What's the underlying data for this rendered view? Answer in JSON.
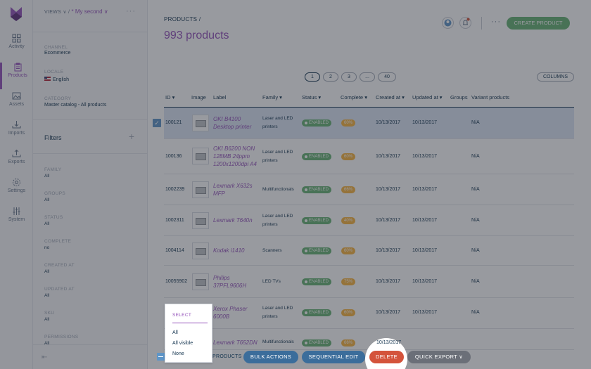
{
  "nav": {
    "items": [
      {
        "label": "Activity",
        "icon": "grid-icon"
      },
      {
        "label": "Products",
        "icon": "clipboard-icon"
      },
      {
        "label": "Assets",
        "icon": "image-icon"
      },
      {
        "label": "Imports",
        "icon": "import-icon"
      },
      {
        "label": "Exports",
        "icon": "export-icon"
      },
      {
        "label": "Settings",
        "icon": "gear-icon"
      },
      {
        "label": "System",
        "icon": "sliders-icon"
      }
    ],
    "active": "Products",
    "accent": "#9452ba"
  },
  "sidebar": {
    "views_label": "VIEWS",
    "view_selected": "* My second",
    "channel": {
      "label": "CHANNEL",
      "value": "Ecommerce"
    },
    "locale": {
      "label": "LOCALE",
      "value": "English"
    },
    "category": {
      "label": "CATEGORY",
      "value": "Master catalog - All products"
    },
    "filters_title": "Filters",
    "filters": [
      {
        "label": "FAMILY",
        "value": "All"
      },
      {
        "label": "GROUPS",
        "value": "All"
      },
      {
        "label": "STATUS",
        "value": "All"
      },
      {
        "label": "COMPLETE",
        "value": "no"
      },
      {
        "label": "CREATED AT",
        "value": "All"
      },
      {
        "label": "UPDATED AT",
        "value": "All"
      },
      {
        "label": "SKU",
        "value": "All"
      },
      {
        "label": "PERMISSIONS",
        "value": "All"
      }
    ]
  },
  "header": {
    "breadcrumb": "PRODUCTS /",
    "count": "993 products",
    "create_label": "CREATE PRODUCT",
    "more": "···"
  },
  "pager": {
    "pages": [
      "1",
      "2",
      "3",
      "...",
      "40"
    ],
    "current": "1",
    "columns_label": "COLUMNS"
  },
  "table": {
    "headers": {
      "id": "ID",
      "image": "Image",
      "label": "Label",
      "family": "Family",
      "status": "Status",
      "complete": "Complete",
      "created": "Created at",
      "updated": "Updated at",
      "groups": "Groups",
      "variants": "Variant products"
    },
    "rows": [
      {
        "id": "100121",
        "label": [
          "OKI B4100",
          "Desktop printer"
        ],
        "family": [
          "Laser and LED",
          "printers"
        ],
        "status": "ENABLED",
        "complete": "60%",
        "created": "10/13/2017",
        "updated": "10/13/2017",
        "variants": "N/A",
        "selected": true
      },
      {
        "id": "100136",
        "label": [
          "OKI B6200 NON",
          "128MB 24ppm",
          "1200x1200dpi A4"
        ],
        "family": [
          "Laser and LED",
          "printers"
        ],
        "status": "ENABLED",
        "complete": "60%",
        "created": "10/13/2017",
        "updated": "10/13/2017",
        "variants": "N/A"
      },
      {
        "id": "1002239",
        "label": [
          "Lexmark X632s",
          "MFP"
        ],
        "family": [
          "Multifunctionals"
        ],
        "status": "ENABLED",
        "complete": "66%",
        "created": "10/13/2017",
        "updated": "10/13/2017",
        "variants": "N/A"
      },
      {
        "id": "1002311",
        "label": [
          "Lexmark T640n"
        ],
        "family": [
          "Laser and LED",
          "printers"
        ],
        "status": "ENABLED",
        "complete": "40%",
        "created": "10/13/2017",
        "updated": "10/13/2017",
        "variants": "N/A"
      },
      {
        "id": "1004114",
        "label": [
          "Kodak i1410"
        ],
        "family": [
          "Scanners"
        ],
        "status": "ENABLED",
        "complete": "60%",
        "created": "10/13/2017",
        "updated": "10/13/2017",
        "variants": "N/A"
      },
      {
        "id": "10055902",
        "label": [
          "Philips",
          "37PFL9606H"
        ],
        "family": [
          "LED TVs"
        ],
        "status": "ENABLED",
        "complete": "75%",
        "created": "10/13/2017",
        "updated": "10/13/2017",
        "variants": "N/A"
      },
      {
        "id": "",
        "label": [
          "Xerox Phaser",
          "6000B"
        ],
        "family": [
          "Laser and LED",
          "printers"
        ],
        "status": "ENABLED",
        "complete": "60%",
        "created": "10/13/2017",
        "updated": "10/13/2017",
        "variants": "N/A"
      },
      {
        "id": "",
        "label": [
          "Lexmark T652DN"
        ],
        "family": [
          "Multifunctionals"
        ],
        "status": "ENABLED",
        "complete": "66%",
        "created": "10/13/2017",
        "updated": "",
        "variants": ""
      }
    ]
  },
  "select_menu": {
    "title": "SELECT",
    "options": [
      "All",
      "All visible",
      "None"
    ]
  },
  "bottom_bar": {
    "products_label": "PRODUCTS",
    "bulk_actions": "BULK ACTIONS",
    "sequential_edit": "SEQUENTIAL EDIT",
    "delete": "DELETE",
    "quick_export": "QUICK EXPORT"
  }
}
